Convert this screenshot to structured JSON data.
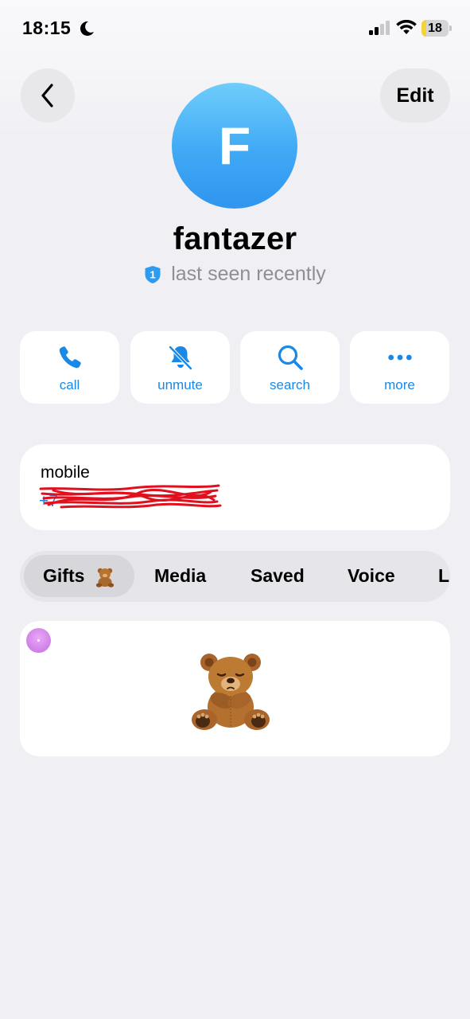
{
  "status_bar": {
    "time": "18:15",
    "battery": "18",
    "battery_level": 0.18
  },
  "nav": {
    "edit_label": "Edit"
  },
  "profile": {
    "avatar_letter": "F",
    "name": "fantazer",
    "status_badge_number": "1",
    "last_seen": "last seen recently"
  },
  "actions": [
    {
      "label": "call",
      "icon": "phone-icon"
    },
    {
      "label": "unmute",
      "icon": "bell-slash-icon"
    },
    {
      "label": "search",
      "icon": "search-icon"
    },
    {
      "label": "more",
      "icon": "ellipsis-icon"
    }
  ],
  "contact": {
    "label": "mobile",
    "value_prefix": "+7"
  },
  "tabs": [
    {
      "label": "Gifts",
      "icon": "teddy-bear-icon",
      "active": true
    },
    {
      "label": "Media"
    },
    {
      "label": "Saved"
    },
    {
      "label": "Voice"
    },
    {
      "label": "L"
    }
  ],
  "gifts": [
    {
      "icon": "teddy-bear-icon"
    }
  ],
  "colors": {
    "accent": "#1a88e6",
    "background": "#efeff4",
    "avatar_top": "#6fcdfb",
    "avatar_bottom": "#2f95ee",
    "scribble": "#e0101e",
    "secondary_text": "#8e8e93"
  }
}
